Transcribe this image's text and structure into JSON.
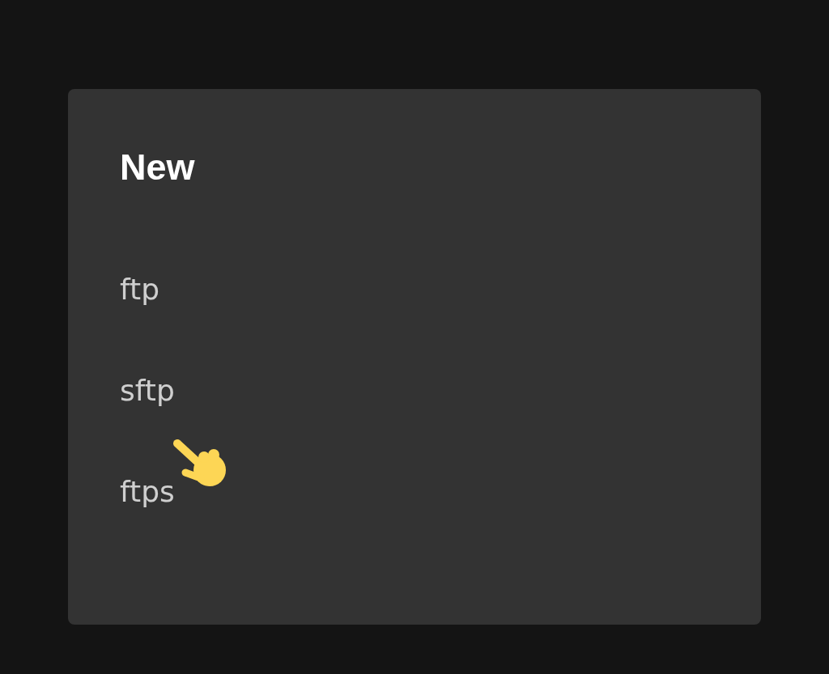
{
  "dialog": {
    "title": "New",
    "items": [
      {
        "label": "ftp"
      },
      {
        "label": "sftp"
      },
      {
        "label": "ftps"
      }
    ]
  }
}
